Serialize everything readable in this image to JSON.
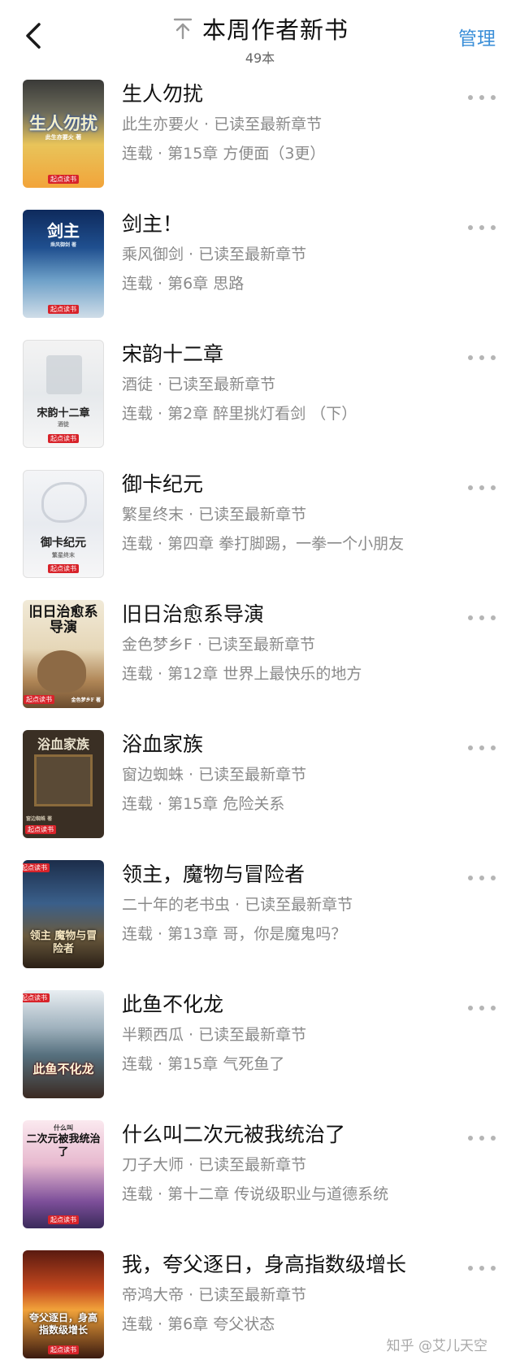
{
  "header": {
    "title": "本周作者新书",
    "count": "49本",
    "manage_label": "管理",
    "back_icon": "chevron-left-icon",
    "top_icon": "scroll-to-top-icon"
  },
  "colors": {
    "accent": "#3b8fd8",
    "publisher_badge": "#d8232a"
  },
  "books": [
    {
      "title": "生人勿扰",
      "author_status": "此生亦要火 · 已读至最新章节",
      "chapter": "连载 · 第15章 方便面（3更）",
      "cover_text": "生人勿扰",
      "cover_sub": "此生亦要火 著",
      "publisher": "起点读书"
    },
    {
      "title": "剑主！",
      "author_status": "乘风御剑 · 已读至最新章节",
      "chapter": "连载 · 第6章 思路",
      "cover_text": "剑主",
      "cover_sub": "乘风御剑 著",
      "publisher": "起点读书"
    },
    {
      "title": "宋韵十二章",
      "author_status": "酒徒 · 已读至最新章节",
      "chapter": "连载 · 第2章 醉里挑灯看剑 （下）",
      "cover_text": "宋韵十二章",
      "cover_sub": "酒徒",
      "publisher": "起点读书"
    },
    {
      "title": "御卡纪元",
      "author_status": "繁星终末 · 已读至最新章节",
      "chapter": "连载 · 第四章 拳打脚踢，一拳一个小朋友",
      "cover_text": "御卡纪元",
      "cover_sub": "繁星终末",
      "publisher": "起点读书"
    },
    {
      "title": "旧日治愈系导演",
      "author_status": "金色梦乡F · 已读至最新章节",
      "chapter": "连载 · 第12章 世界上最快乐的地方",
      "cover_text": "旧日治愈系导演",
      "cover_sub": "金色梦乡F 著",
      "publisher": "起点读书"
    },
    {
      "title": "浴血家族",
      "author_status": "窗边蜘蛛 · 已读至最新章节",
      "chapter": "连载 · 第15章 危险关系",
      "cover_text": "浴血家族",
      "cover_sub": "窗边蜘蛛 著",
      "publisher": "起点读书"
    },
    {
      "title": "领主，魔物与冒险者",
      "author_status": "二十年的老书虫 · 已读至最新章节",
      "chapter": "连载 · 第13章 哥，你是魔鬼吗？",
      "cover_text": "领主 魔物与冒险者",
      "cover_sub": "",
      "publisher": "起点读书"
    },
    {
      "title": "此鱼不化龙",
      "author_status": "半颗西瓜 · 已读至最新章节",
      "chapter": "连载 · 第15章 气死鱼了",
      "cover_text": "此鱼不化龙",
      "cover_sub": "",
      "publisher": "起点读书"
    },
    {
      "title": "什么叫二次元被我统治了",
      "author_status": "刀子大师 · 已读至最新章节",
      "chapter": "连载 · 第十二章 传说级职业与道德系统",
      "cover_text": "二次元被我统治了",
      "cover_sub": "什么叫",
      "publisher": "起点读书"
    },
    {
      "title": "我，夸父逐日，身高指数级增长",
      "author_status": "帝鸿大帝 · 已读至最新章节",
      "chapter": "连载 · 第6章 夸父状态",
      "cover_text": "夸父逐日，身高指数级增长",
      "cover_sub": "",
      "publisher": "起点读书"
    }
  ],
  "more_icon": "more-horizontal-icon",
  "watermark": "知乎 @艾儿天空"
}
